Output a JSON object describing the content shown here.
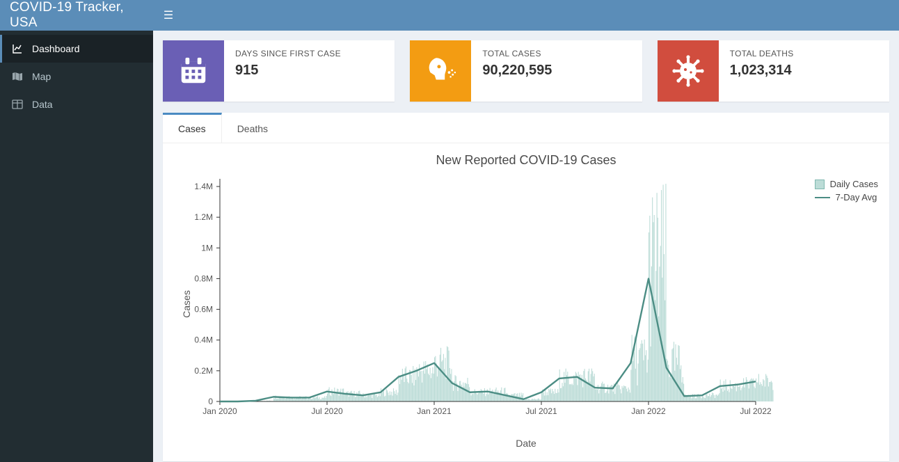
{
  "app": {
    "title": "COVID-19 Tracker, USA"
  },
  "sidebar": {
    "items": [
      {
        "label": "Dashboard"
      },
      {
        "label": "Map"
      },
      {
        "label": "Data"
      }
    ]
  },
  "cards": {
    "days": {
      "label": "DAYS SINCE FIRST CASE",
      "value": "915"
    },
    "cases": {
      "label": "TOTAL CASES",
      "value": "90,220,595"
    },
    "deaths": {
      "label": "TOTAL DEATHS",
      "value": "1,023,314"
    }
  },
  "tabs": [
    {
      "label": "Cases"
    },
    {
      "label": "Deaths"
    }
  ],
  "chart_data": {
    "type": "line+bar",
    "title": "New Reported COVID-19 Cases",
    "xlabel": "Date",
    "ylabel": "Cases",
    "x_ticks": [
      "Jan 2020",
      "Jul 2020",
      "Jan 2021",
      "Jul 2021",
      "Jan 2022",
      "Jul 2022"
    ],
    "y_ticks": [
      0,
      200000,
      400000,
      600000,
      800000,
      1000000,
      1200000,
      1400000
    ],
    "y_tick_labels": [
      "0",
      "0.2M",
      "0.4M",
      "0.6M",
      "0.8M",
      "1M",
      "1.2M",
      "1.4M"
    ],
    "ylim": [
      0,
      1450000
    ],
    "legend": [
      "Daily Cases",
      "7-Day Avg"
    ],
    "series": [
      {
        "name": "7-Day Avg",
        "type": "line",
        "color": "#4b8d84",
        "x": [
          "2020-01",
          "2020-02",
          "2020-03",
          "2020-04",
          "2020-05",
          "2020-06",
          "2020-07",
          "2020-08",
          "2020-09",
          "2020-10",
          "2020-11",
          "2020-12",
          "2021-01",
          "2021-02",
          "2021-03",
          "2021-04",
          "2021-05",
          "2021-06",
          "2021-07",
          "2021-08",
          "2021-09",
          "2021-10",
          "2021-11",
          "2021-12",
          "2022-01",
          "2022-02",
          "2022-03",
          "2022-04",
          "2022-05",
          "2022-06",
          "2022-07"
        ],
        "y": [
          0,
          0,
          5000,
          30000,
          25000,
          25000,
          65000,
          50000,
          40000,
          60000,
          160000,
          200000,
          250000,
          120000,
          60000,
          65000,
          40000,
          15000,
          60000,
          150000,
          160000,
          90000,
          85000,
          250000,
          800000,
          220000,
          35000,
          40000,
          100000,
          110000,
          130000
        ]
      },
      {
        "name": "Daily Cases",
        "type": "bar",
        "color": "#bcdcd7",
        "note": "daily values fluctuate roughly ±40% around the 7-day average line; visual peak ≈1.4M mid-Jan 2022",
        "peak": 1400000
      }
    ]
  }
}
